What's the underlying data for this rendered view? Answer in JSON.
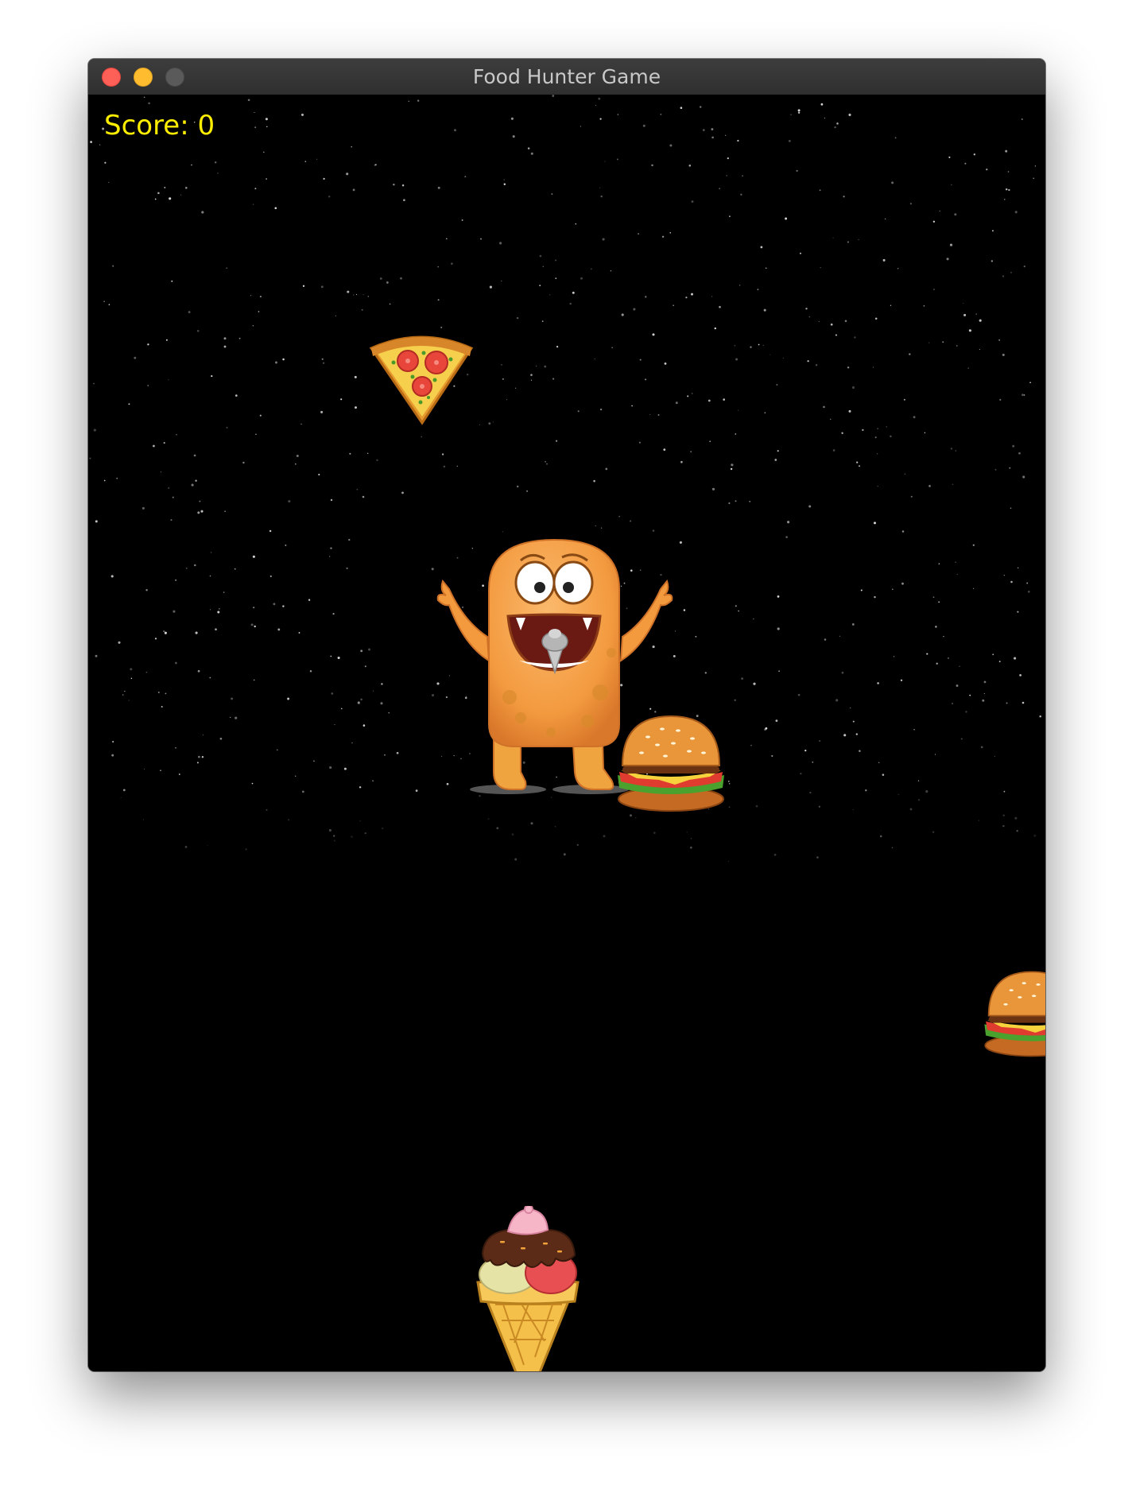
{
  "window": {
    "title": "Food Hunter Game"
  },
  "hud": {
    "score_label": "Score: 0"
  },
  "colors": {
    "score_text": "#ffee00",
    "background": "#000000",
    "title_bar": "#353535"
  },
  "sprites": {
    "player": "orange-monster-icon",
    "foods": [
      "pizza-slice-icon",
      "burger-icon",
      "burger-icon",
      "ice-cream-cone-icon"
    ]
  }
}
